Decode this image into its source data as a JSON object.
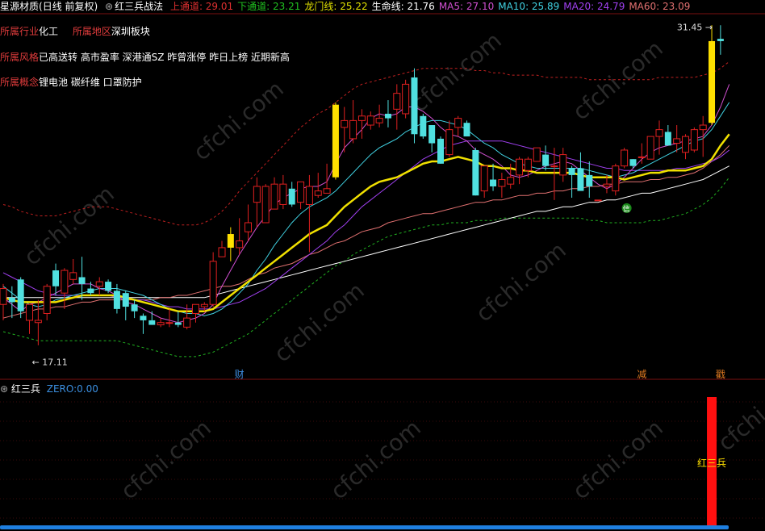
{
  "header": {
    "stock": "星源材质",
    "period": "(日线 前复权)",
    "strategy": "红三兵战法",
    "items": [
      {
        "label": "上通道:",
        "value": "29.01",
        "color": "#e03030"
      },
      {
        "label": "下通道:",
        "value": "23.21",
        "color": "#20c020"
      },
      {
        "label": "龙门线:",
        "value": "25.22",
        "color": "#e0e000"
      },
      {
        "label": "生命线:",
        "value": "21.76",
        "color": "#ffffff"
      },
      {
        "label": "MA5:",
        "value": "27.10",
        "color": "#d050d0"
      },
      {
        "label": "MA10:",
        "value": "25.89",
        "color": "#40d0e0"
      },
      {
        "label": "MA20:",
        "value": "24.79",
        "color": "#a040f0"
      },
      {
        "label": "MA60:",
        "value": "23.09",
        "color": "#e07070"
      }
    ]
  },
  "info": {
    "industry_key": "所属行业",
    "industry": "化工",
    "region_key": "所属地区",
    "region": "深圳板块",
    "style_key": "所属风格",
    "style": "已高送转 高市盈率 深港通SZ 昨曾涨停 昨日上榜 近期新高",
    "concept_key": "所属概念",
    "concept": "锂电池 碳纤维 口罩防护"
  },
  "markers": {
    "high": "31.45",
    "low": "17.11",
    "cai": "财",
    "jian": "减",
    "chuo": "戳",
    "mid_badge": "信"
  },
  "indicator": {
    "name": "红三兵",
    "zero_label": "ZERO:",
    "zero_value": "0.00",
    "bar_label": "红三兵"
  },
  "watermark": "cfchi.com",
  "colors": {
    "up": "#e02020",
    "down": "#50e0e0",
    "signal": "#ffe000",
    "bg": "#000000"
  },
  "chart_data": {
    "type": "candlestick",
    "price_range": [
      16.4,
      31.9
    ],
    "candles": [
      [
        19.2,
        20.1,
        18.5,
        19.9
      ],
      [
        19.5,
        20.0,
        18.6,
        19.3
      ],
      [
        20.3,
        20.4,
        18.6,
        18.9
      ],
      [
        18.5,
        19.2,
        17.9,
        19.2
      ],
      [
        18.4,
        19.4,
        17.4,
        18.5
      ],
      [
        18.8,
        20.1,
        18.5,
        20.0
      ],
      [
        20.7,
        21.0,
        19.6,
        20.0
      ],
      [
        19.7,
        20.8,
        19.0,
        20.7
      ],
      [
        20.3,
        21.2,
        20.1,
        20.6
      ],
      [
        20.4,
        21.3,
        19.4,
        20.1
      ],
      [
        19.9,
        20.2,
        19.6,
        19.7
      ],
      [
        20.0,
        20.4,
        19.6,
        20.2
      ],
      [
        20.2,
        20.3,
        19.7,
        19.8
      ],
      [
        19.8,
        20.1,
        18.8,
        19.0
      ],
      [
        19.7,
        19.8,
        18.5,
        19.1
      ],
      [
        19.2,
        19.4,
        18.6,
        18.9
      ],
      [
        18.7,
        18.8,
        17.9,
        18.5
      ],
      [
        18.5,
        18.9,
        18.3,
        18.3
      ],
      [
        18.3,
        18.6,
        18.2,
        18.4
      ],
      [
        18.4,
        19.0,
        18.2,
        18.4
      ],
      [
        18.4,
        18.9,
        18.2,
        18.3
      ],
      [
        18.2,
        19.2,
        18.1,
        18.6
      ],
      [
        18.8,
        19.2,
        18.4,
        19.2
      ],
      [
        19.1,
        19.3,
        18.9,
        19.2
      ],
      [
        19.2,
        21.5,
        19.1,
        21.1
      ],
      [
        21.3,
        22.0,
        21.3,
        21.7
      ],
      [
        21.7,
        22.6,
        21.1,
        22.3
      ],
      [
        21.7,
        23.0,
        21.4,
        22.0
      ],
      [
        22.4,
        23.6,
        22.0,
        22.8
      ],
      [
        23.7,
        24.8,
        22.6,
        24.4
      ],
      [
        22.8,
        24.5,
        22.8,
        24.4
      ],
      [
        23.4,
        24.8,
        23.4,
        24.5
      ],
      [
        23.6,
        24.9,
        23.4,
        24.5
      ],
      [
        24.3,
        24.6,
        23.5,
        23.6
      ],
      [
        23.7,
        24.6,
        23.4,
        24.6
      ],
      [
        23.6,
        24.9,
        21.5,
        24.4
      ],
      [
        24.0,
        25.0,
        23.9,
        24.2
      ],
      [
        24.1,
        25.4,
        24.1,
        24.3
      ],
      [
        24.8,
        28.1,
        24.7,
        28.0
      ],
      [
        27.0,
        27.9,
        25.9,
        27.3
      ],
      [
        26.5,
        28.2,
        26.3,
        27.3
      ],
      [
        27.3,
        27.8,
        26.5,
        27.5
      ],
      [
        27.1,
        27.7,
        26.9,
        27.5
      ],
      [
        27.2,
        28.0,
        27.0,
        27.4
      ],
      [
        27.6,
        28.2,
        27.0,
        27.4
      ],
      [
        27.8,
        28.9,
        26.9,
        28.5
      ],
      [
        27.6,
        29.1,
        27.4,
        28.9
      ],
      [
        29.2,
        29.6,
        26.3,
        26.7
      ],
      [
        27.5,
        27.6,
        26.5,
        26.6
      ],
      [
        27.1,
        27.1,
        25.9,
        26.3
      ],
      [
        26.5,
        26.6,
        25.4,
        25.4
      ],
      [
        25.8,
        27.3,
        25.7,
        26.9
      ],
      [
        27.0,
        27.5,
        26.6,
        27.4
      ],
      [
        27.2,
        27.3,
        26.8,
        26.6
      ],
      [
        26.0,
        26.1,
        24.0,
        24.0
      ],
      [
        24.2,
        25.3,
        23.9,
        25.3
      ],
      [
        24.7,
        25.4,
        24.2,
        24.4
      ],
      [
        24.4,
        25.0,
        23.9,
        24.7
      ],
      [
        24.5,
        25.4,
        24.3,
        24.8
      ],
      [
        24.9,
        25.7,
        24.5,
        25.6
      ],
      [
        25.1,
        25.7,
        24.8,
        25.6
      ],
      [
        25.5,
        26.1,
        25.5,
        26.1
      ],
      [
        25.8,
        26.2,
        25.1,
        25.3
      ],
      [
        25.3,
        26.1,
        23.8,
        25.3
      ],
      [
        24.9,
        26.1,
        24.6,
        25.8
      ],
      [
        25.2,
        25.3,
        23.9,
        24.9
      ],
      [
        25.2,
        25.9,
        24.3,
        24.2
      ],
      [
        24.9,
        25.5,
        23.9,
        24.4
      ],
      [
        23.8,
        23.8,
        23.8,
        23.8
      ],
      [
        24.4,
        24.9,
        24.1,
        24.5
      ],
      [
        24.2,
        25.4,
        24.0,
        25.3
      ],
      [
        25.3,
        26.1,
        25.2,
        26.0
      ],
      [
        25.6,
        25.6,
        25.2,
        25.3
      ],
      [
        25.7,
        26.3,
        25.4,
        25.7
      ],
      [
        25.6,
        26.6,
        25.6,
        26.6
      ],
      [
        26.6,
        27.3,
        25.8,
        26.9
      ],
      [
        26.8,
        27.1,
        26.2,
        26.2
      ],
      [
        26.3,
        27.1,
        25.9,
        26.5
      ],
      [
        25.9,
        26.7,
        25.6,
        26.6
      ],
      [
        26.0,
        27.0,
        25.9,
        26.9
      ],
      [
        26.9,
        27.5,
        25.7,
        27.1
      ],
      [
        27.2,
        31.5,
        27.1,
        30.8
      ],
      [
        30.9,
        31.5,
        30.2,
        30.8
      ]
    ],
    "signal_candles": [
      26,
      38,
      81
    ],
    "ma5": [
      19.5,
      19.2,
      18.9,
      19.2,
      19.3,
      19.5,
      19.7,
      19.9,
      20.1,
      20.1,
      20.1,
      19.9,
      19.8,
      19.6,
      19.3,
      19.2,
      19.0,
      18.8,
      18.6,
      18.5,
      18.4,
      18.5,
      18.6,
      18.8,
      19.2,
      20.0,
      20.7,
      21.4,
      22.0,
      22.6,
      23.1,
      23.6,
      23.9,
      24.1,
      24.3,
      24.4,
      24.4,
      24.6,
      25.4,
      26.1,
      26.5,
      26.9,
      27.4,
      27.6,
      27.5,
      27.6,
      27.9,
      27.9,
      27.7,
      27.4,
      27.0,
      26.7,
      26.6,
      26.4,
      26.0,
      25.8,
      25.6,
      25.3,
      24.9,
      24.8,
      24.9,
      25.1,
      25.3,
      25.4,
      25.5,
      25.4,
      25.1,
      24.8,
      24.5,
      24.3,
      24.5,
      24.8,
      25.2,
      25.6,
      25.9,
      26.1,
      26.2,
      26.3,
      26.4,
      26.5,
      26.6,
      27.1,
      27.9,
      28.9
    ],
    "ma10": [
      20.0,
      19.7,
      19.4,
      19.2,
      19.1,
      19.2,
      19.4,
      19.5,
      19.6,
      19.7,
      19.8,
      19.9,
      19.9,
      19.9,
      19.8,
      19.7,
      19.6,
      19.4,
      19.2,
      19.0,
      18.9,
      18.8,
      18.8,
      18.7,
      18.8,
      19.0,
      19.3,
      19.7,
      20.1,
      20.7,
      21.2,
      21.8,
      22.3,
      22.8,
      23.2,
      23.5,
      23.7,
      23.9,
      24.2,
      24.6,
      25.0,
      25.4,
      25.8,
      26.1,
      26.3,
      26.5,
      26.8,
      27.0,
      27.2,
      27.3,
      27.3,
      27.2,
      27.1,
      26.9,
      26.6,
      26.3,
      26.1,
      25.8,
      25.6,
      25.4,
      25.3,
      25.2,
      25.2,
      25.2,
      25.2,
      25.2,
      25.2,
      25.1,
      25.0,
      24.9,
      24.8,
      24.9,
      25.0,
      25.2,
      25.4,
      25.6,
      25.8,
      26.0,
      26.2,
      26.4,
      26.5,
      26.9,
      27.5,
      28.1
    ],
    "ma20": [
      20.6,
      20.4,
      20.2,
      20.0,
      19.8,
      19.7,
      19.6,
      19.6,
      19.6,
      19.6,
      19.6,
      19.6,
      19.6,
      19.5,
      19.5,
      19.4,
      19.4,
      19.3,
      19.2,
      19.1,
      19.1,
      19.0,
      19.0,
      19.0,
      19.0,
      19.1,
      19.2,
      19.3,
      19.5,
      19.7,
      19.9,
      20.2,
      20.5,
      20.8,
      21.1,
      21.4,
      21.7,
      22.0,
      22.4,
      22.7,
      23.1,
      23.5,
      23.8,
      24.1,
      24.4,
      24.7,
      25.0,
      25.3,
      25.6,
      25.8,
      26.0,
      26.2,
      26.3,
      26.4,
      26.4,
      26.4,
      26.4,
      26.4,
      26.3,
      26.2,
      26.1,
      26.0,
      25.9,
      25.8,
      25.7,
      25.6,
      25.5,
      25.4,
      25.3,
      25.2,
      25.2,
      25.1,
      25.1,
      25.1,
      25.1,
      25.1,
      25.1,
      25.2,
      25.2,
      25.3,
      25.4,
      25.5,
      25.7,
      26.0
    ],
    "ma60": [
      18.6,
      18.7,
      18.8,
      18.9,
      19.0,
      19.0,
      19.1,
      19.1,
      19.2,
      19.3,
      19.3,
      19.4,
      19.4,
      19.4,
      19.4,
      19.4,
      19.4,
      19.4,
      19.5,
      19.5,
      19.6,
      19.6,
      19.7,
      19.8,
      19.9,
      20.0,
      20.0,
      20.1,
      20.3,
      20.5,
      20.6,
      20.8,
      20.9,
      21.0,
      21.2,
      21.4,
      21.5,
      21.7,
      21.9,
      22.0,
      22.2,
      22.4,
      22.5,
      22.6,
      22.8,
      22.9,
      23.0,
      23.1,
      23.2,
      23.2,
      23.3,
      23.4,
      23.5,
      23.6,
      23.7,
      23.7,
      23.8,
      23.8,
      23.9,
      24.0,
      24.0,
      24.1,
      24.1,
      24.2,
      24.2,
      24.3,
      24.3,
      24.4,
      24.4,
      24.5,
      24.5,
      24.6,
      24.6,
      24.6,
      24.7,
      24.7,
      24.8,
      24.8,
      24.9,
      25.0,
      25.2,
      25.5,
      25.8,
      26.2
    ],
    "dragon": [
      19.5,
      19.4,
      19.3,
      19.3,
      19.3,
      19.3,
      19.3,
      19.4,
      19.5,
      19.6,
      19.6,
      19.6,
      19.6,
      19.6,
      19.5,
      19.4,
      19.3,
      19.2,
      19.1,
      19.0,
      18.9,
      18.9,
      18.9,
      18.9,
      19.0,
      19.3,
      19.6,
      19.9,
      20.2,
      20.5,
      20.8,
      21.1,
      21.4,
      21.7,
      22.0,
      22.3,
      22.5,
      22.7,
      23.1,
      23.5,
      23.8,
      24.1,
      24.4,
      24.6,
      24.7,
      24.8,
      25.0,
      25.2,
      25.4,
      25.5,
      25.5,
      25.6,
      25.7,
      25.6,
      25.5,
      25.3,
      25.3,
      25.2,
      25.2,
      25.1,
      25.1,
      25.0,
      25.0,
      25.0,
      25.0,
      25.0,
      24.9,
      24.8,
      24.8,
      24.8,
      24.8,
      24.7,
      24.8,
      24.9,
      25.0,
      25.0,
      25.1,
      25.1,
      25.1,
      25.2,
      25.3,
      25.6,
      26.2,
      26.7
    ],
    "life": [
      19.5,
      19.5,
      19.5,
      19.5,
      19.5,
      19.5,
      19.5,
      19.5,
      19.5,
      19.5,
      19.5,
      19.5,
      19.5,
      19.5,
      19.5,
      19.5,
      19.5,
      19.5,
      19.5,
      19.5,
      19.5,
      19.5,
      19.5,
      19.5,
      19.6,
      19.7,
      19.8,
      19.9,
      20.0,
      20.1,
      20.2,
      20.3,
      20.4,
      20.5,
      20.6,
      20.7,
      20.8,
      20.9,
      21.0,
      21.1,
      21.2,
      21.3,
      21.4,
      21.5,
      21.6,
      21.7,
      21.8,
      21.9,
      22.0,
      22.1,
      22.2,
      22.3,
      22.4,
      22.5,
      22.6,
      22.7,
      22.8,
      22.9,
      23.0,
      23.1,
      23.2,
      23.3,
      23.3,
      23.4,
      23.5,
      23.5,
      23.6,
      23.7,
      23.7,
      23.8,
      23.8,
      23.9,
      24.0,
      24.1,
      24.1,
      24.2,
      24.3,
      24.4,
      24.5,
      24.6,
      24.7,
      24.9,
      25.1,
      25.3
    ],
    "upper": [
      23.6,
      23.5,
      23.3,
      23.2,
      23.1,
      23.1,
      23.1,
      23.2,
      23.3,
      23.4,
      23.5,
      23.5,
      23.5,
      23.4,
      23.3,
      23.2,
      23.1,
      23.0,
      22.9,
      22.8,
      22.7,
      22.7,
      22.7,
      22.8,
      23.0,
      23.3,
      23.7,
      24.2,
      24.6,
      25.0,
      25.4,
      25.8,
      26.2,
      26.6,
      27.0,
      27.3,
      27.6,
      27.8,
      28.1,
      28.4,
      28.7,
      28.9,
      29.0,
      29.1,
      29.2,
      29.3,
      29.4,
      29.5,
      29.6,
      29.6,
      29.6,
      29.6,
      29.6,
      29.6,
      29.5,
      29.5,
      29.4,
      29.4,
      29.3,
      29.3,
      29.3,
      29.3,
      29.2,
      29.2,
      29.2,
      29.2,
      29.2,
      29.1,
      29.1,
      29.1,
      29.1,
      29.1,
      29.1,
      29.1,
      29.1,
      29.2,
      29.2,
      29.2,
      29.2,
      29.2,
      29.3,
      29.4,
      29.6,
      29.9
    ],
    "lower": [
      18.0,
      17.9,
      17.8,
      17.7,
      17.6,
      17.6,
      17.6,
      17.6,
      17.6,
      17.6,
      17.6,
      17.6,
      17.6,
      17.6,
      17.5,
      17.4,
      17.3,
      17.2,
      17.1,
      17.0,
      16.9,
      16.9,
      16.9,
      17.0,
      17.1,
      17.3,
      17.5,
      17.7,
      17.9,
      18.2,
      18.5,
      18.8,
      19.1,
      19.4,
      19.7,
      20.0,
      20.3,
      20.6,
      20.9,
      21.1,
      21.4,
      21.6,
      21.8,
      22.0,
      22.2,
      22.3,
      22.4,
      22.5,
      22.6,
      22.7,
      22.7,
      22.8,
      22.8,
      22.8,
      22.9,
      22.9,
      22.9,
      23.0,
      23.0,
      23.0,
      23.0,
      23.0,
      23.0,
      23.0,
      23.0,
      23.0,
      23.0,
      22.9,
      22.9,
      22.8,
      22.8,
      22.8,
      22.8,
      22.8,
      22.9,
      22.9,
      23.0,
      23.1,
      23.2,
      23.4,
      23.6,
      23.9,
      24.3,
      24.8
    ],
    "indicator_signal_index": 81,
    "indicator_signal_value": 1
  }
}
